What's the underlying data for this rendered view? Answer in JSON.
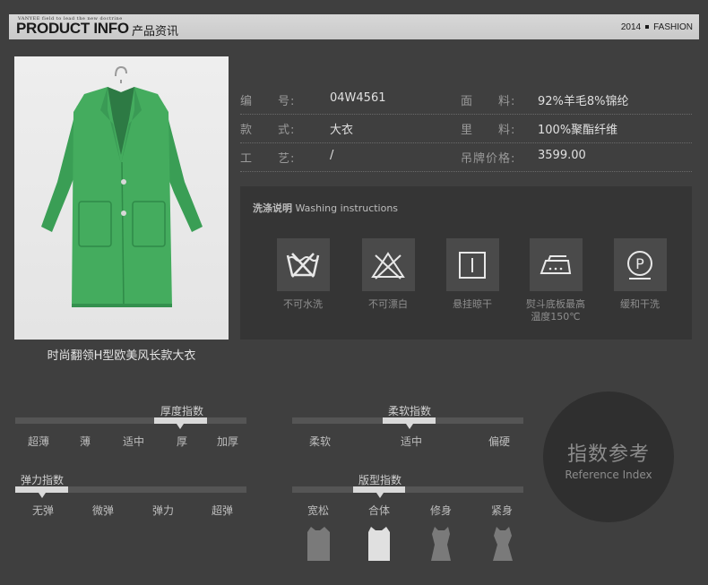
{
  "header": {
    "brand_tag": "VANYEE field to lead the new doctrine",
    "title": "PRODUCT INFO",
    "subtitle": "产品资讯",
    "year": "2014",
    "section": "FASHION"
  },
  "product": {
    "name": "时尚翻领H型欧美风长款大衣",
    "image_alt": "green wool coat"
  },
  "specs": [
    {
      "label": "编　　号:",
      "value": "04W4561",
      "label2": "面　　料:",
      "value2": "92%羊毛8%锦纶"
    },
    {
      "label": "款　　式:",
      "value": "大衣",
      "label2": "里　　料:",
      "value2": "100%聚酯纤维"
    },
    {
      "label": "工　　艺:",
      "value": "/",
      "label2": "吊牌价格:",
      "value2": "3599.00"
    }
  ],
  "washing": {
    "title_cn": "洗涤说明",
    "title_en": "Washing instructions",
    "items": [
      {
        "icon": "no-wash-icon",
        "label": "不可水洗"
      },
      {
        "icon": "no-bleach-icon",
        "label": "不可漂白"
      },
      {
        "icon": "hang-dry-icon",
        "label": "悬挂晾干"
      },
      {
        "icon": "iron-icon",
        "label": "熨斗底板最高温度150℃"
      },
      {
        "icon": "dry-clean-icon",
        "label": "缓和干洗"
      }
    ]
  },
  "indices": {
    "thickness": {
      "title": "厚度指数",
      "options": [
        "超薄",
        "薄",
        "适中",
        "厚",
        "加厚"
      ],
      "selected": 3
    },
    "softness": {
      "title": "柔软指数",
      "options": [
        "柔软",
        "适中",
        "偏硬"
      ],
      "selected": 1
    },
    "elasticity": {
      "title": "弹力指数",
      "options": [
        "无弹",
        "微弹",
        "弹力",
        "超弹"
      ],
      "selected": 0
    },
    "fit": {
      "title": "版型指数",
      "options": [
        "宽松",
        "合体",
        "修身",
        "紧身"
      ],
      "selected": 1
    }
  },
  "reference": {
    "cn": "指数参考",
    "en": "Reference Index"
  },
  "colors": {
    "background": "#3f3f3f",
    "coat_green": "#3fa85a",
    "highlight": "#d9d9d9"
  }
}
